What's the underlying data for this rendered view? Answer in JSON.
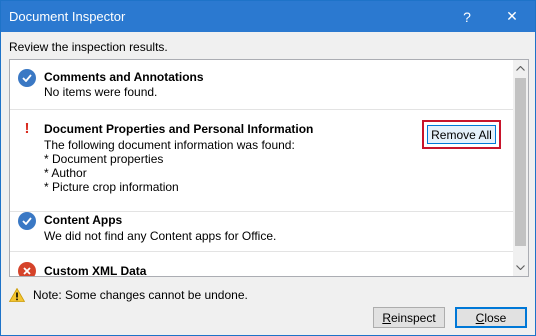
{
  "window": {
    "title": "Document Inspector",
    "help_glyph": "?",
    "close_glyph": "✕"
  },
  "subtitle": "Review the inspection results.",
  "results": [
    {
      "status": "ok",
      "icon": "checkmark-icon",
      "title": "Comments and Annotations",
      "lines": [
        "No items were found."
      ]
    },
    {
      "status": "found",
      "icon": "exclamation-icon",
      "title": "Document Properties and Personal Information",
      "lines": [
        "The following document information was found:",
        "* Document properties",
        "* Author",
        "* Picture crop information"
      ],
      "action_label": "Remove All"
    },
    {
      "status": "ok",
      "icon": "checkmark-icon",
      "title": "Content Apps",
      "lines": [
        "We did not find any Content apps for Office."
      ]
    },
    {
      "status": "error",
      "icon": "error-icon",
      "title": "Custom XML Data",
      "lines": []
    }
  ],
  "note": "Note: Some changes cannot be undone.",
  "buttons": {
    "reinspect_first": "R",
    "reinspect_rest": "einspect",
    "close_first": "C",
    "close_rest": "lose"
  },
  "colors": {
    "titlebar": "#2b79d0",
    "highlight_border": "#c8142b",
    "check": "#3a78c4",
    "error": "#d5432a"
  }
}
